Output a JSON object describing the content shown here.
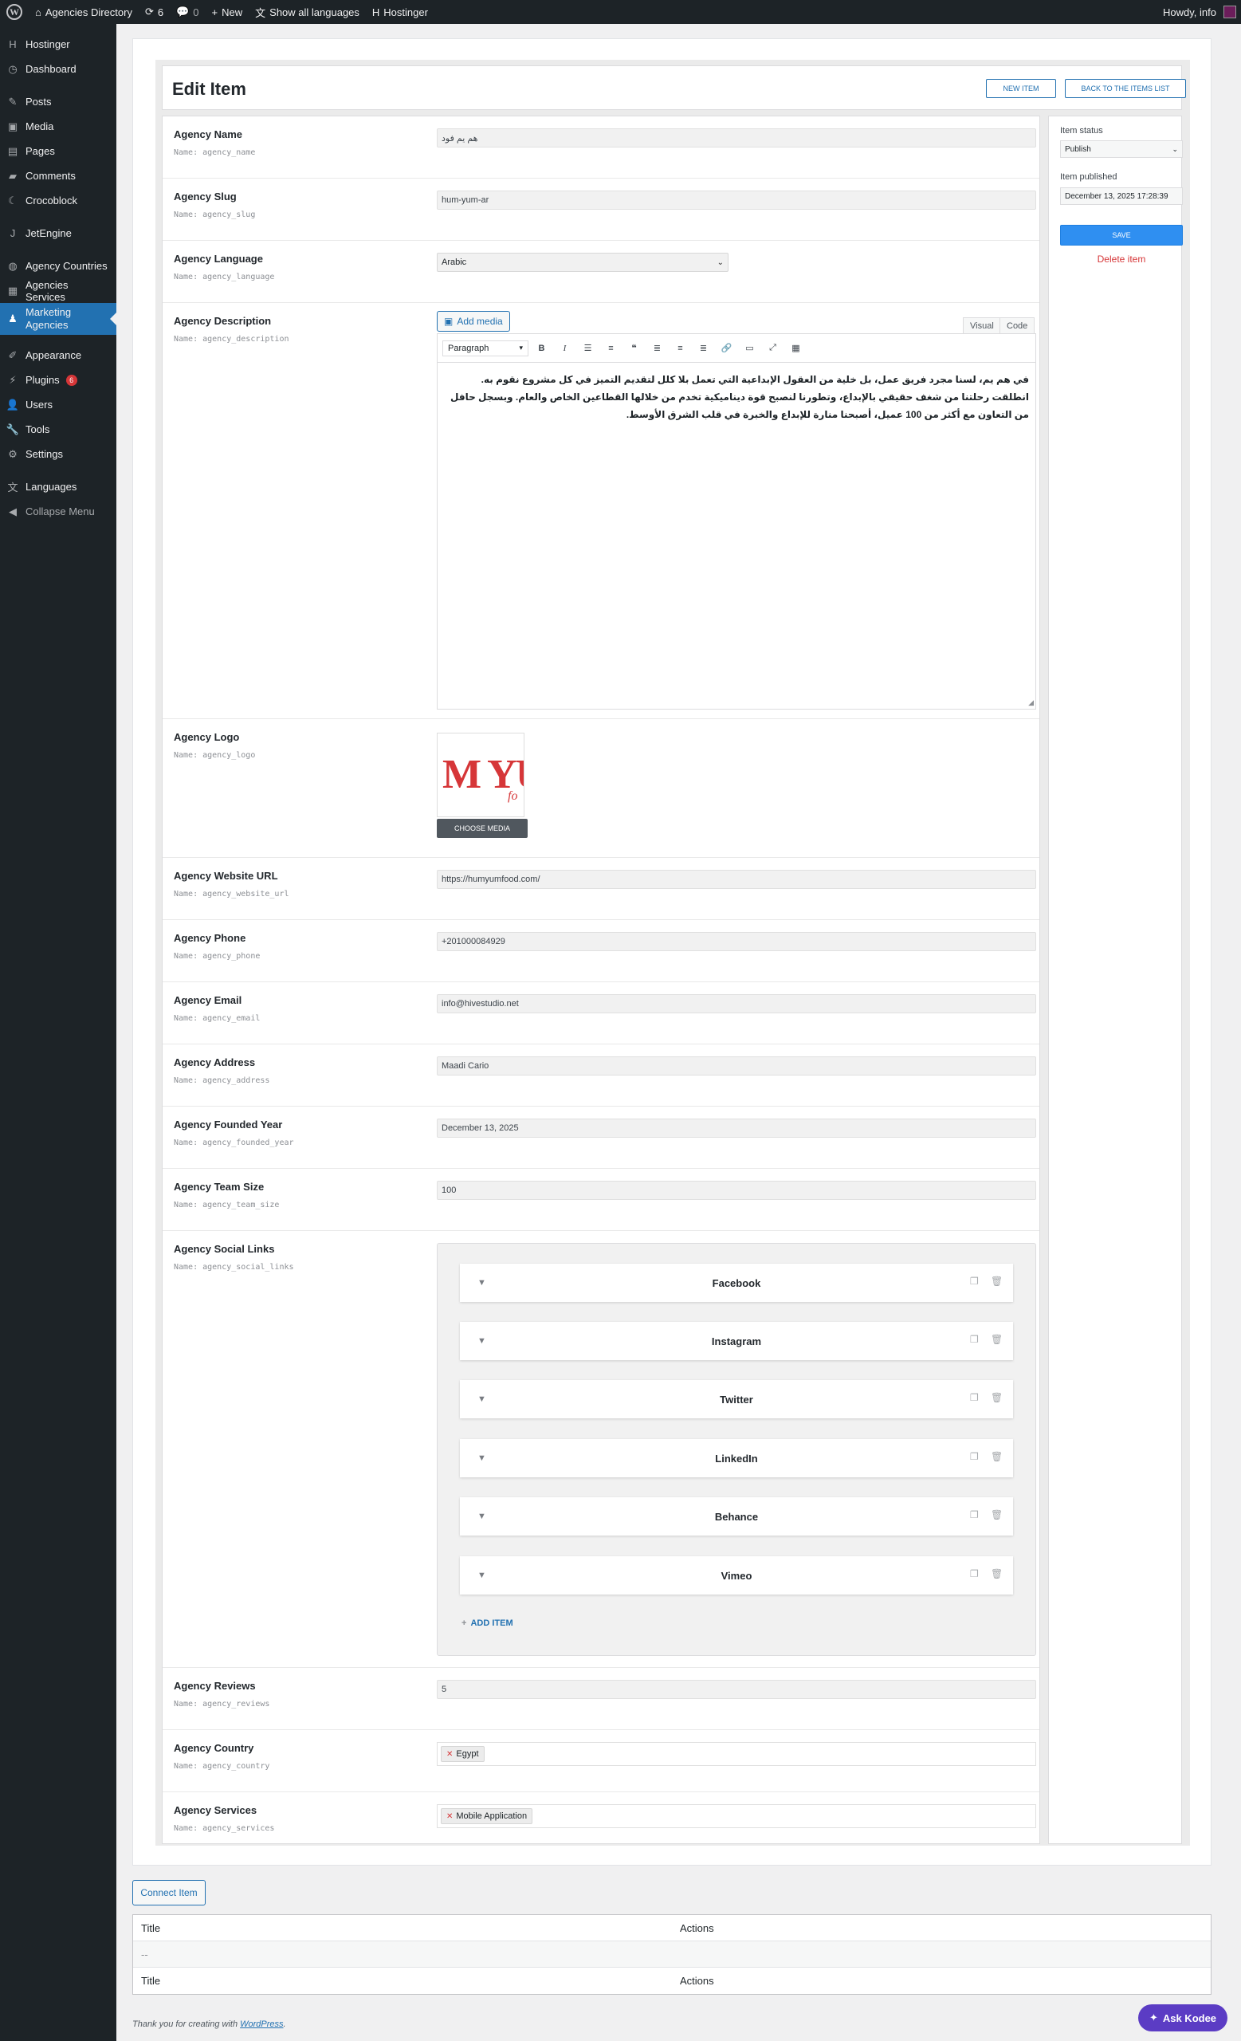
{
  "adminbar": {
    "site_name": "Agencies Directory",
    "updates_count": "6",
    "comments_count": "0",
    "new_label": "New",
    "languages_label": "Show all languages",
    "hostinger_label": "Hostinger",
    "howdy": "Howdy, info"
  },
  "sidebar": {
    "hostinger": "Hostinger",
    "dashboard": "Dashboard",
    "posts": "Posts",
    "media": "Media",
    "pages": "Pages",
    "comments": "Comments",
    "crocoblock": "Crocoblock",
    "jetengine": "JetEngine",
    "agency_countries": "Agency Countries",
    "agencies_services": "Agencies Services",
    "marketing_agencies": "Marketing Agencies",
    "appearance": "Appearance",
    "plugins": "Plugins",
    "plugins_badge": "6",
    "users": "Users",
    "tools": "Tools",
    "settings": "Settings",
    "languages": "Languages",
    "collapse": "Collapse Menu"
  },
  "page": {
    "title": "Edit Item",
    "new_item": "NEW ITEM",
    "back_to_list": "BACK TO THE ITEMS LIST"
  },
  "fields": {
    "name": {
      "label": "Agency Name",
      "key": "Name: agency_name",
      "value": "هم يم فود"
    },
    "slug": {
      "label": "Agency Slug",
      "key": "Name: agency_slug",
      "value": "hum-yum-ar"
    },
    "language": {
      "label": "Agency Language",
      "key": "Name: agency_language",
      "value": "Arabic"
    },
    "description": {
      "label": "Agency Description",
      "key": "Name: agency_description",
      "add_media": "Add media",
      "tab_visual": "Visual",
      "tab_code": "Code",
      "format": "Paragraph",
      "content": "في هم يم، لسنا مجرد فريق عمل، بل خلية من العقول الإبداعية التي تعمل بلا كلل لتقديم التميز في كل مشروع نقوم به. انطلقت رحلتنا من شغف حقيقي بالإبداع، وتطورنا لنصبح قوة ديناميكية تخدم من خلالها القطاعين الخاص والعام. وبسجل حافل من التعاون مع أكثر من 100 عميل، أصبحنا منارة للإبداع والخبرة في قلب الشرق الأوسط."
    },
    "logo": {
      "label": "Agency Logo",
      "key": "Name: agency_logo",
      "button": "CHOOSE MEDIA",
      "image_text": "M YÙ",
      "image_script": "fo"
    },
    "website": {
      "label": "Agency Website URL",
      "key": "Name: agency_website_url",
      "value": "https://humyumfood.com/"
    },
    "phone": {
      "label": "Agency Phone",
      "key": "Name: agency_phone",
      "value": "+201000084929"
    },
    "email": {
      "label": "Agency Email",
      "key": "Name: agency_email",
      "value": "info@hivestudio.net"
    },
    "address": {
      "label": "Agency Address",
      "key": "Name: agency_address",
      "value": "Maadi Cario"
    },
    "founded": {
      "label": "Agency Founded Year",
      "key": "Name: agency_founded_year",
      "value": "December 13, 2025"
    },
    "team_size": {
      "label": "Agency Team Size",
      "key": "Name: agency_team_size",
      "value": "100"
    },
    "social": {
      "label": "Agency Social Links",
      "key": "Name: agency_social_links",
      "items": [
        "Facebook",
        "Instagram",
        "Twitter",
        "LinkedIn",
        "Behance",
        "Vimeo"
      ],
      "add_item": "ADD ITEM"
    },
    "reviews": {
      "label": "Agency Reviews",
      "key": "Name: agency_reviews",
      "value": "5"
    },
    "country": {
      "label": "Agency Country",
      "key": "Name: agency_country",
      "tag": "Egypt"
    },
    "services": {
      "label": "Agency Services",
      "key": "Name: agency_services",
      "tag": "Mobile Application"
    }
  },
  "status": {
    "status_label": "Item status",
    "status_value": "Publish",
    "published_label": "Item published",
    "published_value": "December 13, 2025 17:28:39",
    "save": "SAVE",
    "delete": "Delete item"
  },
  "connect": {
    "button": "Connect Item",
    "col_title": "Title",
    "col_actions": "Actions",
    "empty": "--"
  },
  "footer": {
    "text": "Thank you for creating with ",
    "link": "WordPress",
    "end": "."
  },
  "assistant": {
    "label": "Ask Kodee"
  },
  "colors": {
    "accent": "#2271b1",
    "sidebar": "#1d2327",
    "save": "#2f8ff1",
    "danger": "#d63638",
    "kodee": "#5b3cc4"
  }
}
